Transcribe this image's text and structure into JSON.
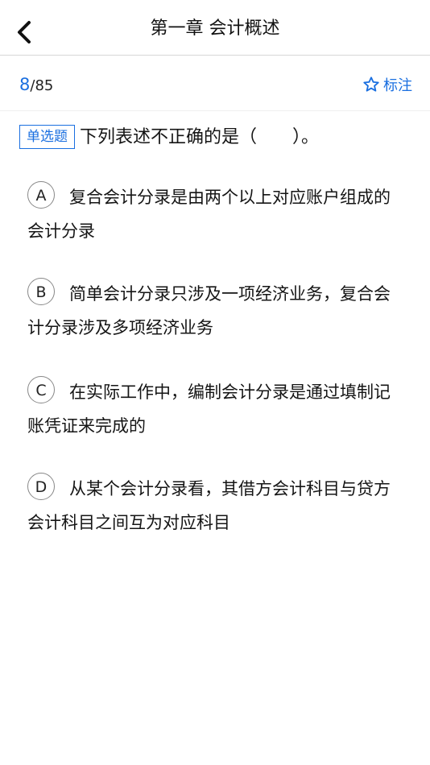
{
  "header": {
    "title": "第一章 会计概述",
    "back_icon": "chevron-left-icon"
  },
  "progress": {
    "current": "8",
    "total": "/85"
  },
  "mark": {
    "icon": "star-outline-icon",
    "label": "标注"
  },
  "colors": {
    "accent": "#1a6fe0"
  },
  "question": {
    "type": "单选题",
    "text": "下列表述不正确的是（　　）。"
  },
  "options": [
    {
      "letter": "A",
      "text": "复合会计分录是由两个以上对应账户组成的会计分录"
    },
    {
      "letter": "B",
      "text": "简单会计分录只涉及一项经济业务，复合会计分录涉及多项经济业务"
    },
    {
      "letter": "C",
      "text": "在实际工作中，编制会计分录是通过填制记账凭证来完成的"
    },
    {
      "letter": "D",
      "text": "从某个会计分录看，其借方会计科目与贷方会计科目之间互为对应科目"
    }
  ]
}
